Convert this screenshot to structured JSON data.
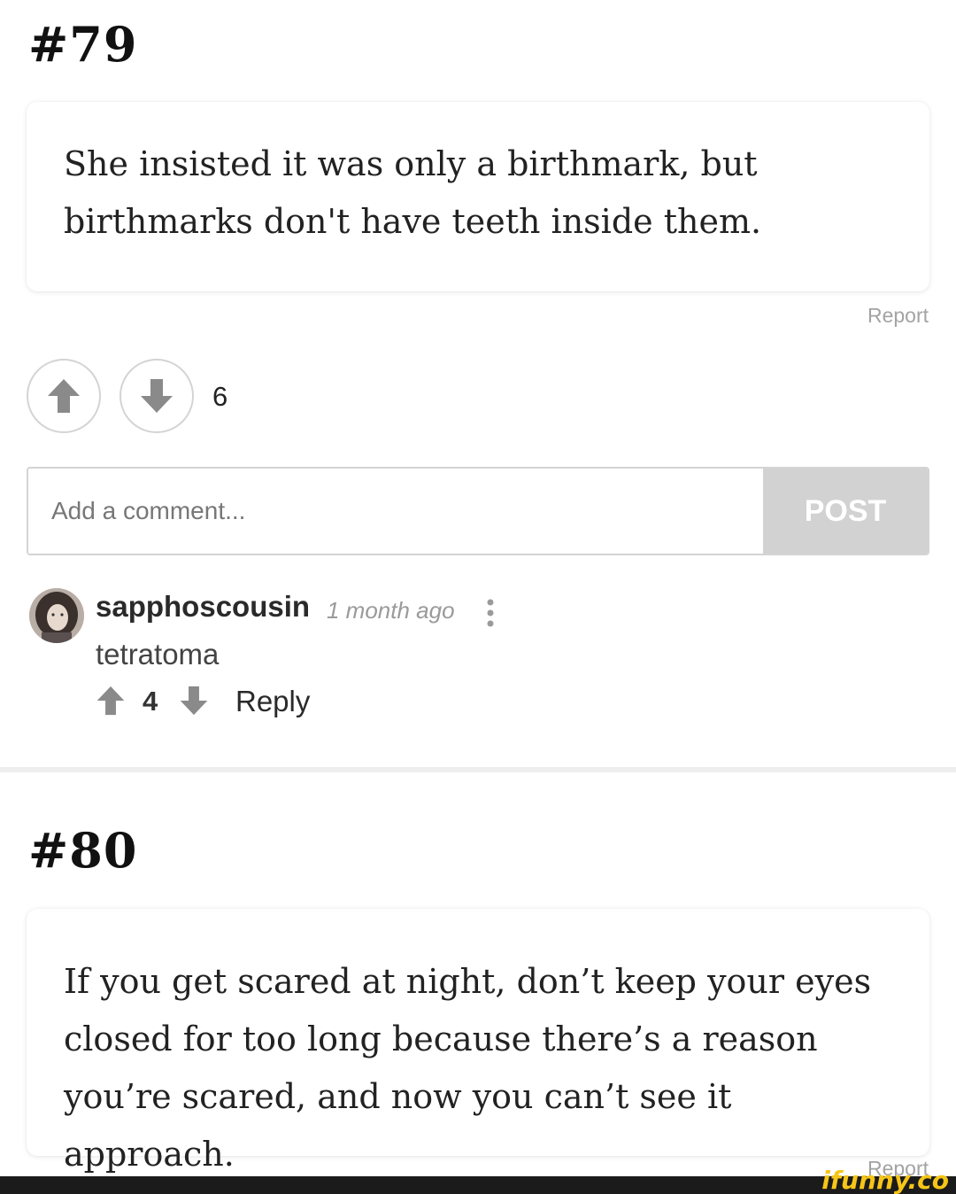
{
  "entries": [
    {
      "number": "#79",
      "text": "She insisted it was only a birthmark, but birthmarks don't have teeth inside them.",
      "report_label": "Report",
      "score": "6"
    },
    {
      "number": "#80",
      "text": "If you get scared at night, don’t keep your eyes closed for too long because there’s a reason you’re scared, and now you can’t see it approach.",
      "report_label": "Report"
    }
  ],
  "comment_form": {
    "placeholder": "Add a comment...",
    "post_label": "POST"
  },
  "comment": {
    "username": "sapphoscousin",
    "time": "1 month ago",
    "text": "tetratoma",
    "score": "4",
    "reply_label": "Reply"
  },
  "watermark": "ifunny.co",
  "colors": {
    "border": "#d4d4d4",
    "post_button": "#d2d2d2",
    "muted_text": "#a3a3a3",
    "watermark": "#f5c518"
  }
}
